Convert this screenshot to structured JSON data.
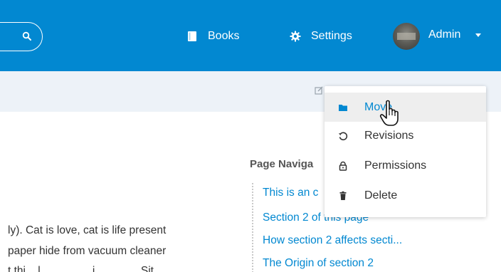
{
  "header": {
    "books_label": "Books",
    "settings_label": "Settings",
    "user_label": "Admin",
    "bg_color": "#0288d1"
  },
  "toolbar": {
    "bg_color": "#edf2f8"
  },
  "content": {
    "lines": [
      "ly). Cat is love, cat is life present",
      "paper hide from vacuum cleaner",
      "t thi... l ... ... ... ... i ... ... ... . Sit..."
    ]
  },
  "page_navigation": {
    "title": "Page Naviga",
    "links": [
      "This is an c",
      "Section 2 of this page",
      "How section 2 affects secti...",
      "The Origin of section 2"
    ]
  },
  "dropdown": {
    "items": [
      {
        "label": "Move",
        "icon": "folder-icon"
      },
      {
        "label": "Revisions",
        "icon": "history-icon"
      },
      {
        "label": "Permissions",
        "icon": "lock-icon"
      },
      {
        "label": "Delete",
        "icon": "trash-icon"
      }
    ]
  }
}
